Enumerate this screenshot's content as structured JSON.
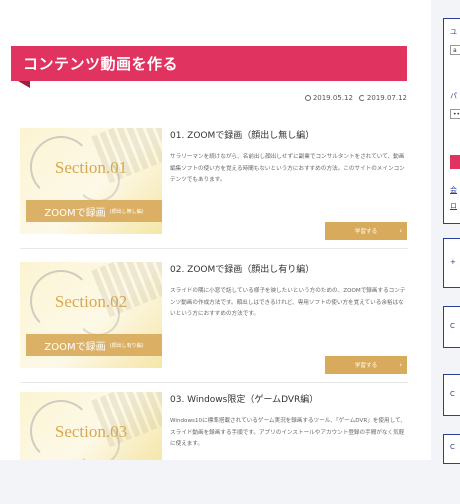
{
  "page": {
    "title": "コンテンツ動画を作る",
    "published": "2019.05.12",
    "updated": "2019.07.12"
  },
  "cards": [
    {
      "thumb_section": "Section.01",
      "thumb_main": "ZOOMで録画",
      "thumb_sub": "(顔出し無し編)",
      "title": "01. ZOOMで録画（顔出し無し編）",
      "desc": "サラリーマンを続けながら、名前出し顔出しせずに副業でコンサルタントをされていて、動画編集ソフトの使い方を覚える時間もないという方におすすめの方法。このサイトのメインコンテンツでもあります。",
      "button": "学習する"
    },
    {
      "thumb_section": "Section.02",
      "thumb_main": "ZOOMで録画",
      "thumb_sub": "(顔出し有り編)",
      "title": "02. ZOOMで録画（顔出し有り編）",
      "desc": "スライドの隅に小窓で話している様子を映したいという方のための、ZOOMで録画するコンテンツ動画の作成方法です。顔出しはできるけれど、専用ソフトの使い方を覚えている余裕はないという方におすすめの方法です。",
      "button": "学習する"
    },
    {
      "thumb_section": "Section.03",
      "title": "03. Windows限定（ゲームDVR編）",
      "desc": "Windows10に標準搭載されているゲーム実況を録画するツール、「ゲームDVR」を使用して、スライド動画を録画する手順です。アプリのインストールやアカウント登録の手間がなく気軽に使えます。"
    }
  ],
  "sidebar": {
    "top_text": "ユ",
    "input1": "a",
    "mid_text": "パ",
    "input2": "••",
    "link1": "会",
    "link2": "ロ",
    "box_labels": [
      "+",
      "C",
      "C",
      "C"
    ]
  },
  "colors": {
    "accent": "#e0335f",
    "gold": "#d8aa5c",
    "sidebar_border": "#2a3f9d"
  }
}
